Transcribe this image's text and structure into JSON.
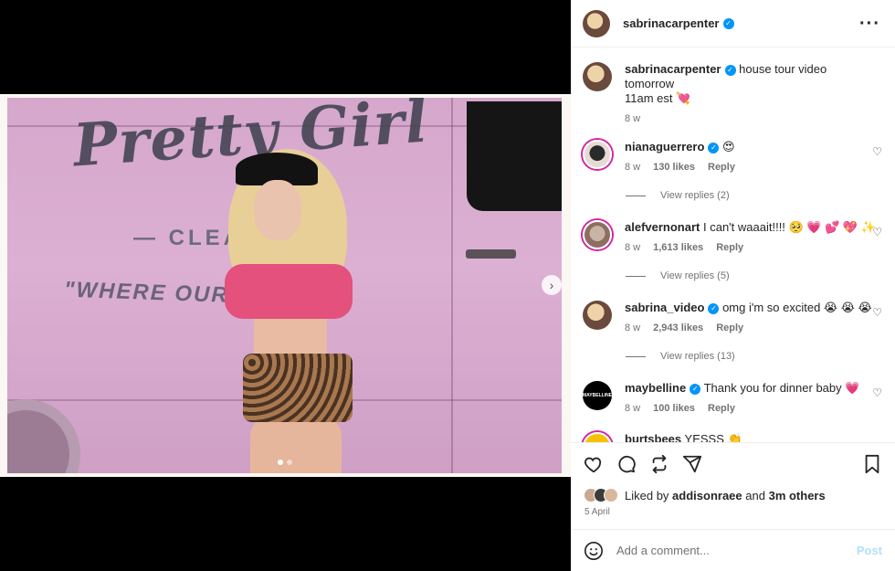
{
  "post": {
    "author": "sabrinacarpenter",
    "image_alt_text": {
      "brand": "Pretty Girl",
      "line2": "— CLEA        W",
      "line3": "\"WHERE   OUR          E TRUE!\""
    },
    "carousel": {
      "index": 1,
      "total": 2
    },
    "caption": {
      "username": "sabrinacarpenter",
      "text_line1": "house tour video",
      "text_line2": "tomorrow",
      "text_line3": "11am est 💘",
      "time": "8 w"
    },
    "likes": {
      "prefix": "Liked by",
      "user": "addisonraee",
      "and": "and",
      "others": "3m others"
    },
    "date": "5 April"
  },
  "comments": [
    {
      "username": "nianaguerrero",
      "text": "😍",
      "time": "8 w",
      "likes": "130 likes",
      "reply": "Reply",
      "view_replies": "View replies (2)"
    },
    {
      "username": "alefvernonart",
      "text": "I can't waaait!!!! 🥺 💗 💕 💖 ✨",
      "time": "8 w",
      "likes": "1,613 likes",
      "reply": "Reply",
      "view_replies": "View replies (5)"
    },
    {
      "username": "sabrina_video",
      "text": "omg i'm so excited 😭 😭 😭",
      "time": "8 w",
      "likes": "2,943 likes",
      "reply": "Reply",
      "view_replies": "View replies (13)"
    },
    {
      "username": "maybelline",
      "text": "Thank you for dinner baby 💗",
      "time": "8 w",
      "likes": "100 likes",
      "reply": "Reply",
      "avatar_text": "MAYBELLINE"
    },
    {
      "username": "burtsbees",
      "text": "YESSS 👏"
    }
  ],
  "composer": {
    "placeholder": "Add a comment...",
    "post_label": "Post"
  },
  "colors": {
    "verified": "#0095f6",
    "post_disabled": "#b2dffc",
    "meta": "#737373"
  },
  "icons": [
    "more-options-icon",
    "like-icon",
    "comment-icon",
    "share-icon",
    "send-icon",
    "bookmark-icon",
    "emoji-icon",
    "next-arrow-icon",
    "verified-icon"
  ]
}
